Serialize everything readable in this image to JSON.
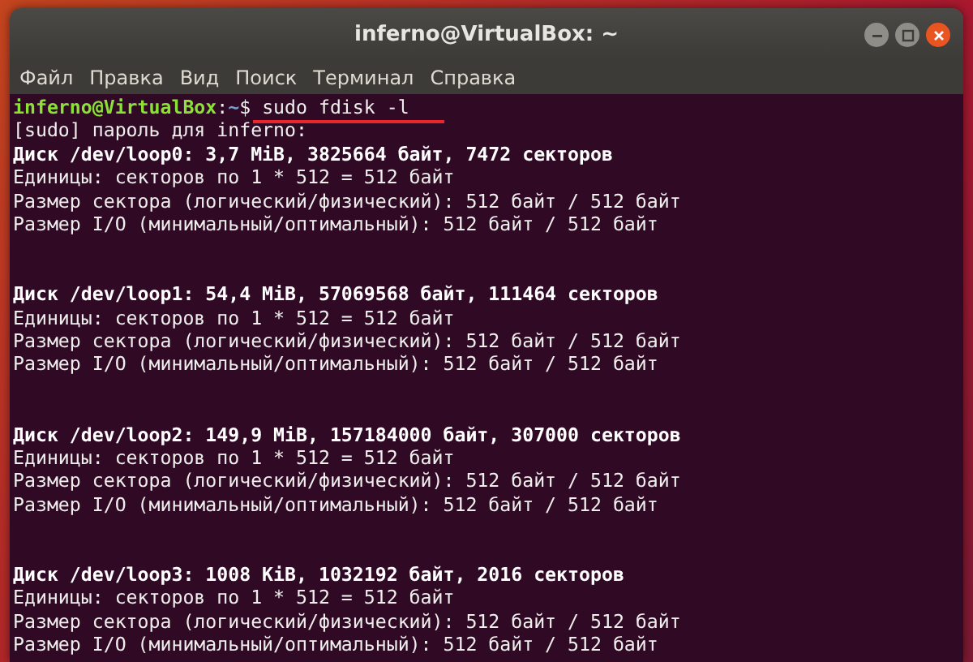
{
  "window": {
    "title": "inferno@VirtualBox: ~"
  },
  "menu": [
    "Файл",
    "Правка",
    "Вид",
    "Поиск",
    "Терминал",
    "Справка"
  ],
  "terminal": {
    "prompt": {
      "user_host": "inferno@VirtualBox",
      "separator": ":",
      "path": "~",
      "symbol": "$",
      "command": "sudo fdisk -l",
      "underlined": true
    },
    "sudo_line": "[sudo] пароль для inferno:",
    "disks": [
      {
        "header": "Диск /dev/loop0: 3,7 MiB, 3825664 байт, 7472 секторов",
        "lines": [
          "Единицы: секторов по 1 * 512 = 512 байт",
          "Размер сектора (логический/физический): 512 байт / 512 байт",
          "Размер I/O (минимальный/оптимальный): 512 байт / 512 байт"
        ]
      },
      {
        "header": "Диск /dev/loop1: 54,4 MiB, 57069568 байт, 111464 секторов",
        "lines": [
          "Единицы: секторов по 1 * 512 = 512 байт",
          "Размер сектора (логический/физический): 512 байт / 512 байт",
          "Размер I/O (минимальный/оптимальный): 512 байт / 512 байт"
        ]
      },
      {
        "header": "Диск /dev/loop2: 149,9 MiB, 157184000 байт, 307000 секторов",
        "lines": [
          "Единицы: секторов по 1 * 512 = 512 байт",
          "Размер сектора (логический/физический): 512 байт / 512 байт",
          "Размер I/O (минимальный/оптимальный): 512 байт / 512 байт"
        ]
      },
      {
        "header": "Диск /dev/loop3: 1008 KiB, 1032192 байт, 2016 секторов",
        "lines": [
          "Единицы: секторов по 1 * 512 = 512 байт",
          "Размер сектора (логический/физический): 512 байт / 512 байт",
          "Размер I/O (минимальный/оптимальный): 512 байт / 512 байт"
        ]
      }
    ]
  }
}
